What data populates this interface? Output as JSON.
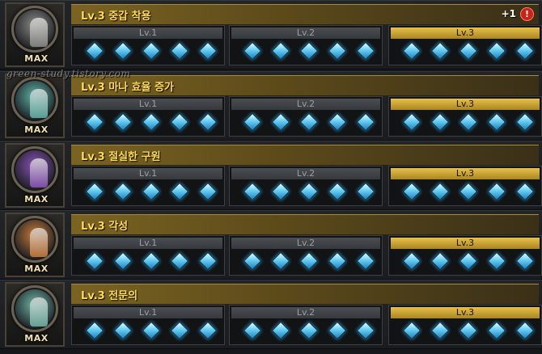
{
  "skills": [
    {
      "title": "Lv.3 중갑 착용",
      "portrait_icon": "armored-knight-icon",
      "portrait_color": "#8b8a86",
      "max_label": "MAX",
      "badge_count": "+1",
      "badge_alert": "!",
      "levels": [
        {
          "label": "Lv.1",
          "gems": 5,
          "active": false
        },
        {
          "label": "Lv.2",
          "gems": 5,
          "active": false
        },
        {
          "label": "Lv.3",
          "gems": 5,
          "active": true
        }
      ]
    },
    {
      "title": "Lv.3 마나 효율 증가",
      "portrait_icon": "mana-spirit-icon",
      "portrait_color": "#5fb3a8",
      "max_label": "MAX",
      "levels": [
        {
          "label": "Lv.1",
          "gems": 5,
          "active": false
        },
        {
          "label": "Lv.2",
          "gems": 5,
          "active": false
        },
        {
          "label": "Lv.3",
          "gems": 5,
          "active": true
        }
      ]
    },
    {
      "title": "Lv.3 절실한 구원",
      "portrait_icon": "purple-mage-icon",
      "portrait_color": "#8a52b8",
      "max_label": "MAX",
      "levels": [
        {
          "label": "Lv.1",
          "gems": 5,
          "active": false
        },
        {
          "label": "Lv.2",
          "gems": 5,
          "active": false
        },
        {
          "label": "Lv.3",
          "gems": 5,
          "active": true
        }
      ]
    },
    {
      "title": "Lv.3 각성",
      "portrait_icon": "awakened-warrior-icon",
      "portrait_color": "#c97a3a",
      "max_label": "MAX",
      "levels": [
        {
          "label": "Lv.1",
          "gems": 5,
          "active": false
        },
        {
          "label": "Lv.2",
          "gems": 5,
          "active": false
        },
        {
          "label": "Lv.3",
          "gems": 5,
          "active": true
        }
      ]
    },
    {
      "title": "Lv.3 전문의",
      "portrait_icon": "healer-figure-icon",
      "portrait_color": "#6fb5a6",
      "max_label": "MAX",
      "levels": [
        {
          "label": "Lv.1",
          "gems": 5,
          "active": false
        },
        {
          "label": "Lv.2",
          "gems": 5,
          "active": false
        },
        {
          "label": "Lv.3",
          "gems": 5,
          "active": true
        }
      ]
    }
  ],
  "watermark": "green-study.tistory.com"
}
